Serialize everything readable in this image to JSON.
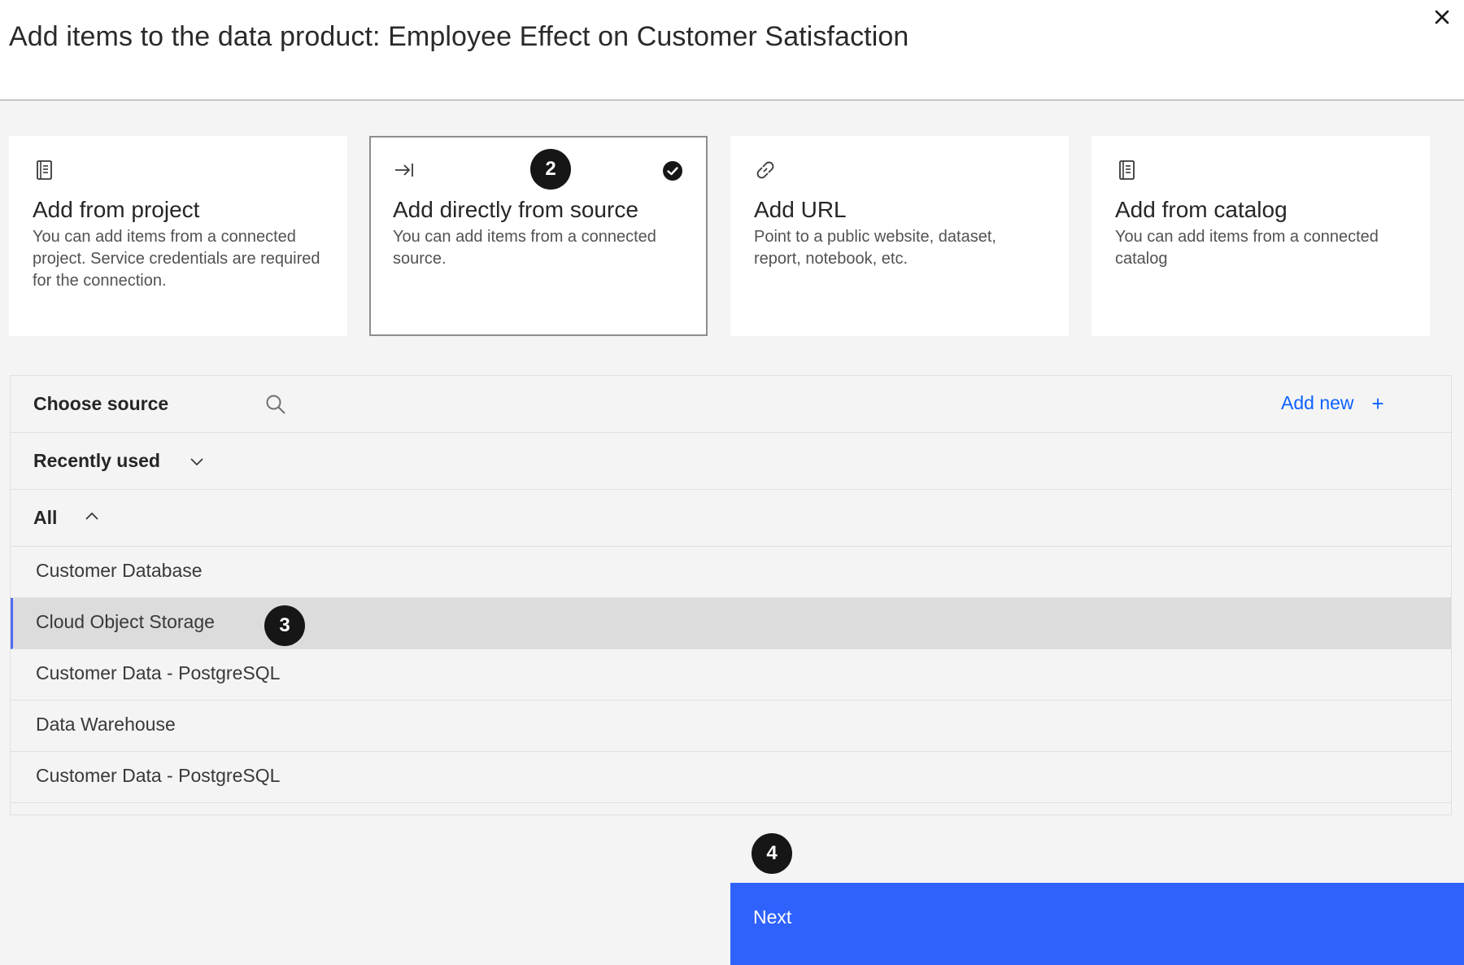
{
  "modal": {
    "title": "Add items to the data product: Employee Effect on Customer Satisfaction",
    "close_icon": "close-icon"
  },
  "tiles": [
    {
      "title": "Add from project",
      "description": "You can add items from a connected project. Service credentials are required for the connection.",
      "icon": "notebook-icon",
      "selected": false
    },
    {
      "title": "Add directly from source",
      "description": "You can add items from a connected source.",
      "icon": "arrow-right-to-line-icon",
      "selected": true
    },
    {
      "title": "Add URL",
      "description": "Point to a public website, dataset, report, notebook, etc.",
      "icon": "link-icon",
      "selected": false
    },
    {
      "title": "Add from catalog",
      "description": "You can add items from a connected catalog",
      "icon": "notebook-icon",
      "selected": false
    }
  ],
  "source": {
    "header_label": "Choose source",
    "add_new_label": "Add new",
    "add_new_plus": "+",
    "recently_used_label": "Recently used",
    "all_label": "All",
    "items": [
      {
        "label": "Customer Database"
      },
      {
        "label": "Cloud Object Storage",
        "active": true
      },
      {
        "label": "Customer Data - PostgreSQL"
      },
      {
        "label": "Data Warehouse"
      },
      {
        "label": "Customer Data - PostgreSQL"
      }
    ]
  },
  "steps": {
    "step2": "2",
    "step3": "3",
    "step4": "4"
  },
  "footer": {
    "next_label": "Next"
  },
  "colors": {
    "primary": "#2f62fd",
    "link": "#0f62fe",
    "active_indicator": "#4f6bed",
    "badge": "#161616"
  }
}
